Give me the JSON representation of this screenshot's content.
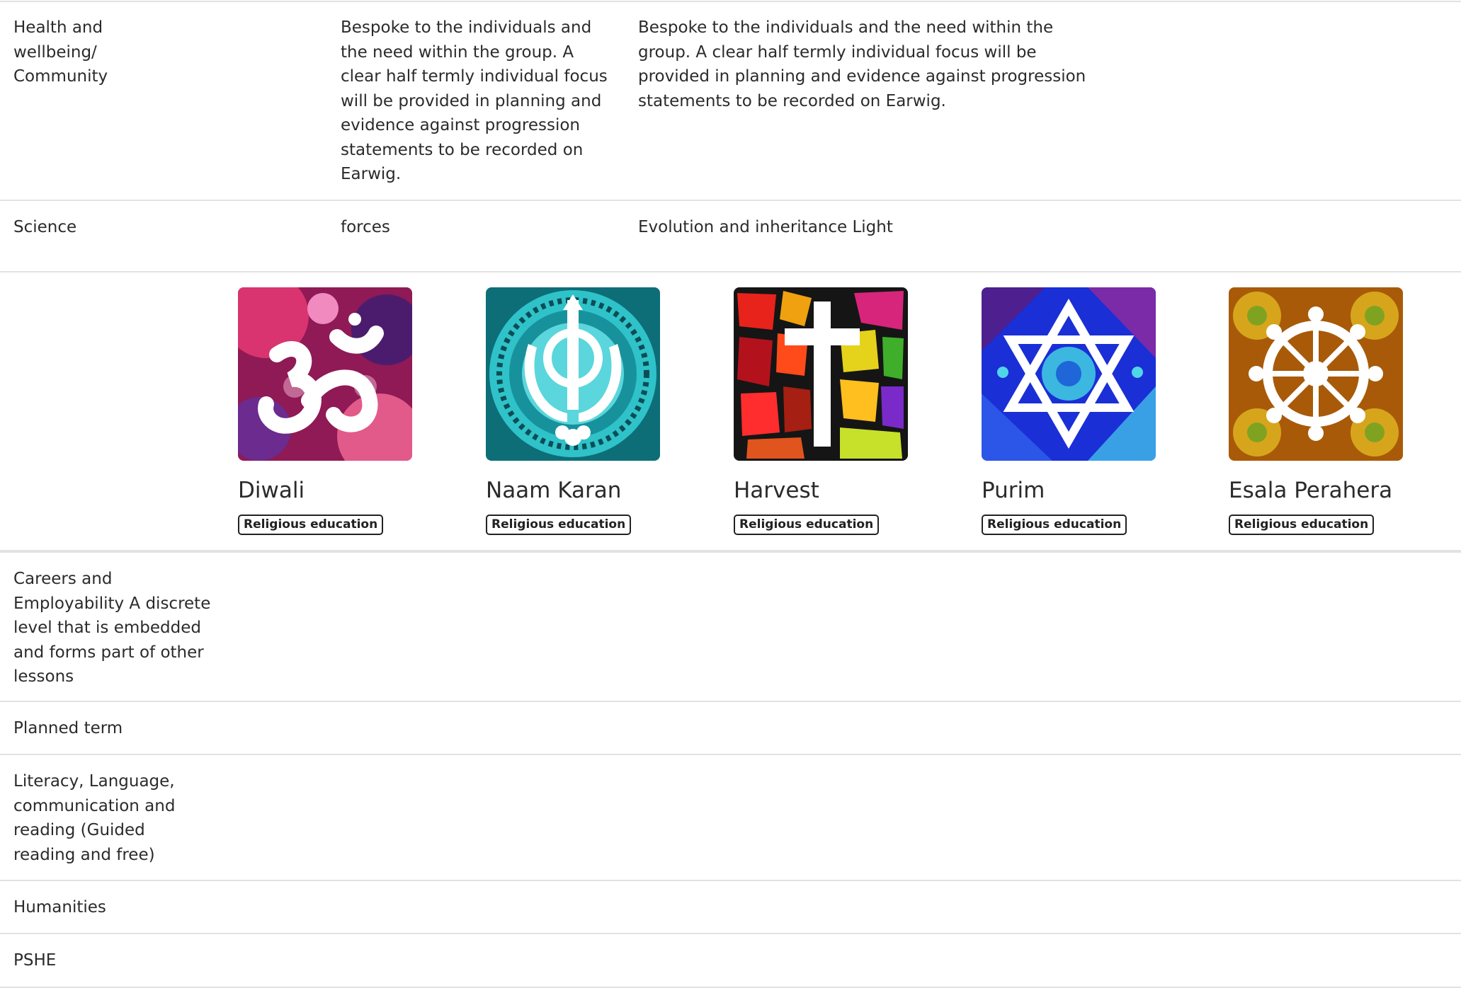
{
  "rows": [
    {
      "subject": "Health and\nwellbeing/\nCommunity",
      "col2": "Bespoke to the individuals and\nthe need within the group. A\nclear half termly individual focus\nwill be provided in planning and\nevidence against progression\nstatements to be recorded on\nEarwig.",
      "col3": "Bespoke to the individuals and the need within the\ngroup. A clear half termly individual focus will be\nprovided in planning and evidence against progression\nstatements to be recorded on Earwig."
    },
    {
      "subject": "Science",
      "col2": "forces",
      "col3": "Evolution and inheritance Light"
    },
    {
      "subject": "Careers and\nEmployability A discrete\nlevel that is embedded\nand forms part of other\nlessons"
    },
    {
      "subject": "Planned term"
    },
    {
      "subject": "Literacy, Language,\ncommunication and\nreading (Guided\nreading and free)"
    },
    {
      "subject": "Humanities"
    },
    {
      "subject": "PSHE"
    }
  ],
  "cards": [
    {
      "title": "Diwali",
      "badge": "Religious education",
      "icon": "om-icon",
      "color": "#b0215e"
    },
    {
      "title": "Naam Karan",
      "badge": "Religious education",
      "icon": "khanda-icon",
      "color": "#1fa9b3"
    },
    {
      "title": "Harvest",
      "badge": "Religious education",
      "icon": "cross-icon",
      "color": "#c8161d"
    },
    {
      "title": "Purim",
      "badge": "Religious education",
      "icon": "star-of-david-icon",
      "color": "#1f2fd1"
    },
    {
      "title": "Esala Perahera",
      "badge": "Religious education",
      "icon": "dharma-wheel-icon",
      "color": "#b86a0a"
    }
  ]
}
